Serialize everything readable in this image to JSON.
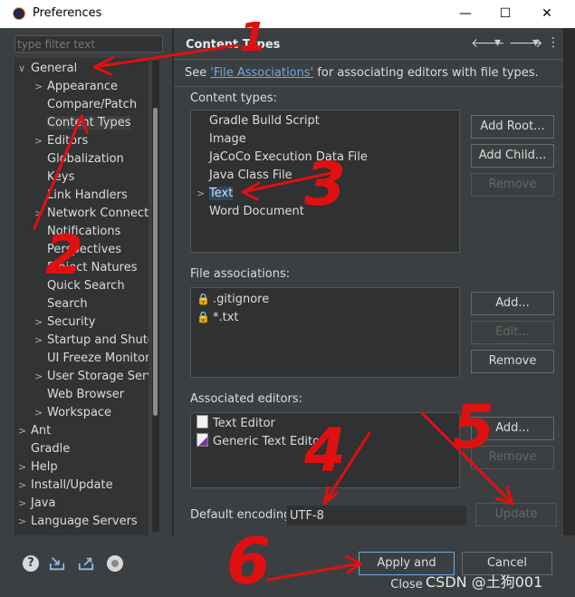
{
  "window": {
    "title": "Preferences",
    "minimize": "—",
    "maximize": "☐",
    "close": "✕"
  },
  "filter": {
    "placeholder": "type filter text"
  },
  "tree": {
    "items": [
      {
        "label": "General",
        "arrow": "∨"
      },
      {
        "label": "Appearance",
        "arrow": ">"
      },
      {
        "label": "Compare/Patch",
        "arrow": ""
      },
      {
        "label": "Content Types",
        "arrow": ""
      },
      {
        "label": "Editors",
        "arrow": ">"
      },
      {
        "label": "Globalization",
        "arrow": ""
      },
      {
        "label": "Keys",
        "arrow": ""
      },
      {
        "label": "Link Handlers",
        "arrow": ""
      },
      {
        "label": "Network Connectio",
        "arrow": ">"
      },
      {
        "label": "Notifications",
        "arrow": ""
      },
      {
        "label": "Perspectives",
        "arrow": ""
      },
      {
        "label": "Project Natures",
        "arrow": ""
      },
      {
        "label": "Quick Search",
        "arrow": ""
      },
      {
        "label": "Search",
        "arrow": ""
      },
      {
        "label": "Security",
        "arrow": ">"
      },
      {
        "label": "Startup and Shutdo",
        "arrow": ">"
      },
      {
        "label": "UI Freeze Monitorin",
        "arrow": ""
      },
      {
        "label": "User Storage Servic",
        "arrow": ">"
      },
      {
        "label": "Web Browser",
        "arrow": ""
      },
      {
        "label": "Workspace",
        "arrow": ">"
      },
      {
        "label": "Ant",
        "arrow": ">"
      },
      {
        "label": "Gradle",
        "arrow": ""
      },
      {
        "label": "Help",
        "arrow": ">"
      },
      {
        "label": "Install/Update",
        "arrow": ">"
      },
      {
        "label": "Java",
        "arrow": ">"
      },
      {
        "label": "Language Servers",
        "arrow": ">"
      }
    ]
  },
  "page": {
    "title": "Content Types",
    "nav_back": "🡐",
    "nav_forward": "🡒",
    "nav_menu": "⋮",
    "desc_pre": "See ",
    "desc_link": "'File Associations'",
    "desc_post": " for associating editors with file types."
  },
  "content_types": {
    "label": "Content types:",
    "items": [
      {
        "label": "Gradle Build Script",
        "arrow": ""
      },
      {
        "label": "Image",
        "arrow": ""
      },
      {
        "label": "JaCoCo Execution Data File",
        "arrow": ""
      },
      {
        "label": "Java Class File",
        "arrow": ""
      },
      {
        "label": "Text",
        "arrow": ">"
      },
      {
        "label": "Word Document",
        "arrow": ""
      }
    ],
    "buttons": {
      "add_root": "Add Root...",
      "add_child": "Add Child...",
      "remove": "Remove"
    }
  },
  "file_associations": {
    "label": "File associations:",
    "items": [
      ".gitignore",
      "*.txt"
    ],
    "buttons": {
      "add": "Add...",
      "edit": "Edit...",
      "remove": "Remove"
    }
  },
  "associated_editors": {
    "label": "Associated editors:",
    "items": [
      "Text Editor",
      "Generic Text Editor"
    ],
    "buttons": {
      "add": "Add...",
      "remove": "Remove"
    }
  },
  "encoding": {
    "label": "Default encoding:",
    "value": "UTF-8",
    "update": "Update"
  },
  "bottom": {
    "help": "?",
    "apply_close": "Apply and Close",
    "cancel": "Cancel",
    "watermark": "CSDN @土狗001"
  },
  "annotations": {
    "n1": "1",
    "n2": "2",
    "n3": "3",
    "n4": "4",
    "n5": "5",
    "n6": "6"
  },
  "colors": {
    "accent": "#6fa8dc",
    "annotation": "#e01010",
    "background": "#3c3f41"
  }
}
